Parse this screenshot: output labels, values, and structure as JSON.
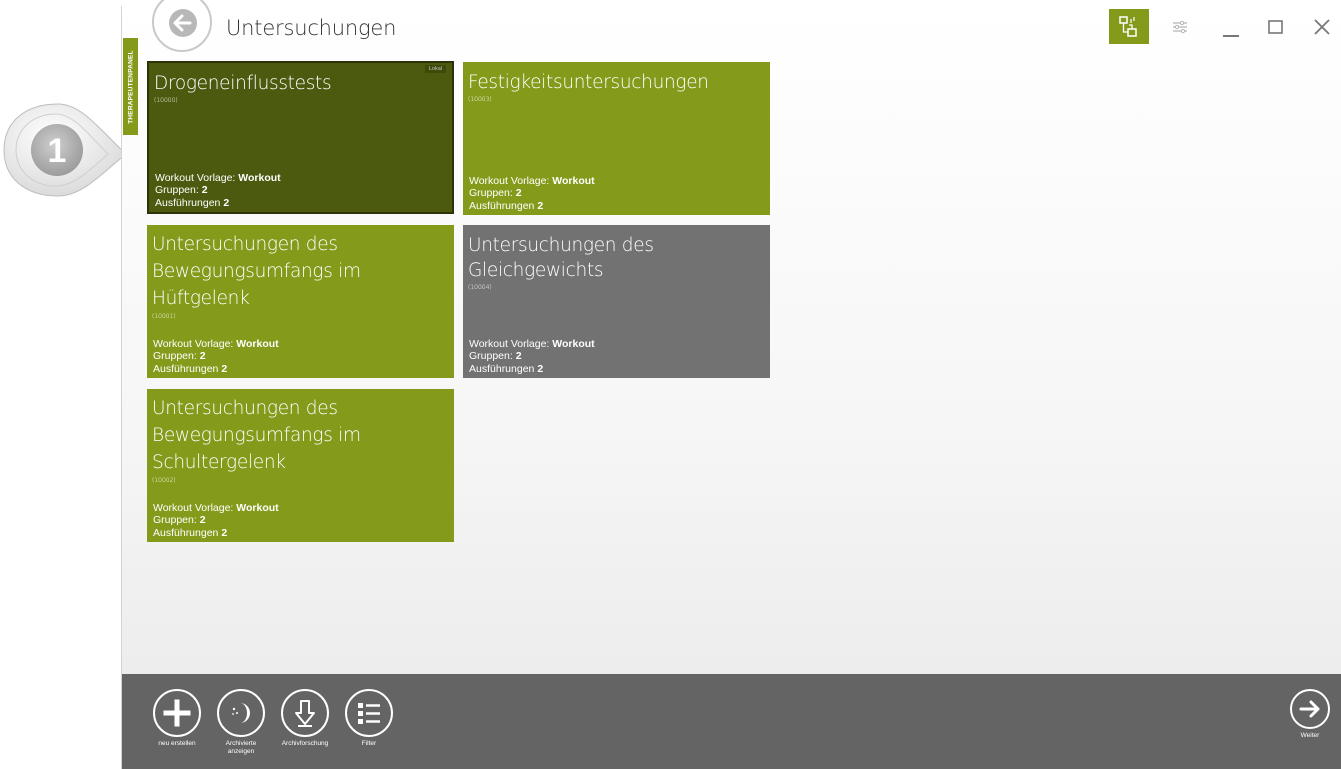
{
  "app": {
    "title": "Untersuchungen",
    "side_tab_label": "THERAPEUTENPANEL",
    "callout_number": "1"
  },
  "window_controls": {
    "icons": [
      "network-icon",
      "settings-sliders-icon",
      "minimize-icon",
      "maximize-icon",
      "close-icon"
    ],
    "accent_color": "#849a1b"
  },
  "tiles": [
    {
      "title": "Drogeneinflusstests",
      "id": "(10000)",
      "tag": "Lokal",
      "template_label": "Workout Vorlage:",
      "template_value": "Workout",
      "groups_label": "Gruppen:",
      "groups_value": "2",
      "runs_label": "Ausführungen",
      "runs_value": "2",
      "color": "#4c5a0f"
    },
    {
      "title": "Festigkeitsuntersuchungen",
      "id": "(10003)",
      "template_label": "Workout Vorlage:",
      "template_value": "Workout",
      "groups_label": "Gruppen:",
      "groups_value": "2",
      "runs_label": "Ausführungen",
      "runs_value": "2",
      "color": "#849a1b"
    },
    {
      "title": "Untersuchungen des Bewegungsumfangs im Hüftgelenk",
      "id": "(10001)",
      "template_label": "Workout Vorlage:",
      "template_value": "Workout",
      "groups_label": "Gruppen:",
      "groups_value": "2",
      "runs_label": "Ausführungen",
      "runs_value": "2",
      "color": "#849a1b"
    },
    {
      "title": "Untersuchungen des Gleichgewichts",
      "id": "(10004)",
      "template_label": "Workout Vorlage:",
      "template_value": "Workout",
      "groups_label": "Gruppen:",
      "groups_value": "2",
      "runs_label": "Ausführungen",
      "runs_value": "2",
      "color": "#727272"
    },
    {
      "title": "Untersuchungen des Bewegungsumfangs im Schultergelenk",
      "id": "(10002)",
      "template_label": "Workout Vorlage:",
      "template_value": "Workout",
      "groups_label": "Gruppen:",
      "groups_value": "2",
      "runs_label": "Ausführungen",
      "runs_value": "2",
      "color": "#849a1b"
    }
  ],
  "toolbar": {
    "new_label": "neu erstellen",
    "archived_label_1": "Archivierte",
    "archived_label_2": "anzeigen",
    "archive_search_label": "Archivforschung",
    "filter_label": "Filter",
    "next_label": "Weiter"
  }
}
